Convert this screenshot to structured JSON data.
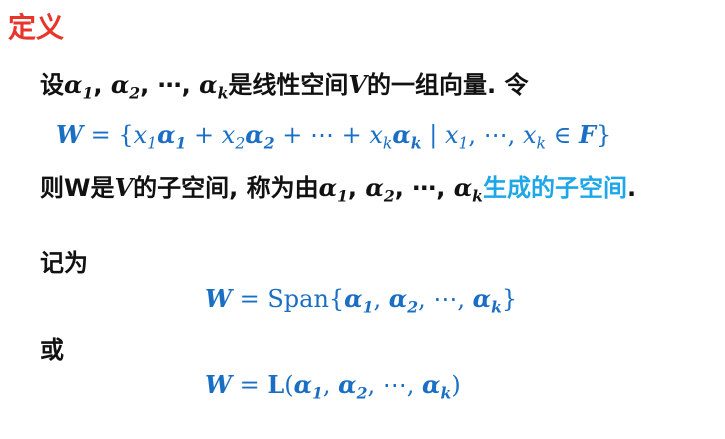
{
  "title": "定义",
  "line1": {
    "pre": "设",
    "alpha": "α",
    "sub1": "1",
    "sub2": "2",
    "subk": "k",
    "comma": ",",
    "dots": "⋯",
    "mid": "是线性空间",
    "V": "V",
    "post": "的一组向量.  令"
  },
  "line2": {
    "W": "W",
    "eq": " = {",
    "x": "x",
    "sub1": "1",
    "sub2": "2",
    "subk": "k",
    "alpha": "α",
    "plus": " + ",
    "dots": "⋯",
    "bar": " | ",
    "comma": ", ",
    "in": " ∈ ",
    "F": "F",
    "close": "}"
  },
  "line3": {
    "pre": "则W是",
    "V": "V",
    "mid": "的子空间, 称为由",
    "highlight": "生成的子空间",
    "end": "."
  },
  "line4": {
    "text": "记为"
  },
  "line5": {
    "W": "W",
    "eq": " = ",
    "span": "Span{",
    "close": "}"
  },
  "line6": {
    "text": "或"
  },
  "line7": {
    "W": "W",
    "eq": " = ",
    "L": "L",
    "open": "(",
    "close": ")"
  },
  "colors": {
    "title": "#e8342a",
    "math": "#1a6fc4",
    "highlight": "#1ea7e8",
    "text": "#111111"
  }
}
